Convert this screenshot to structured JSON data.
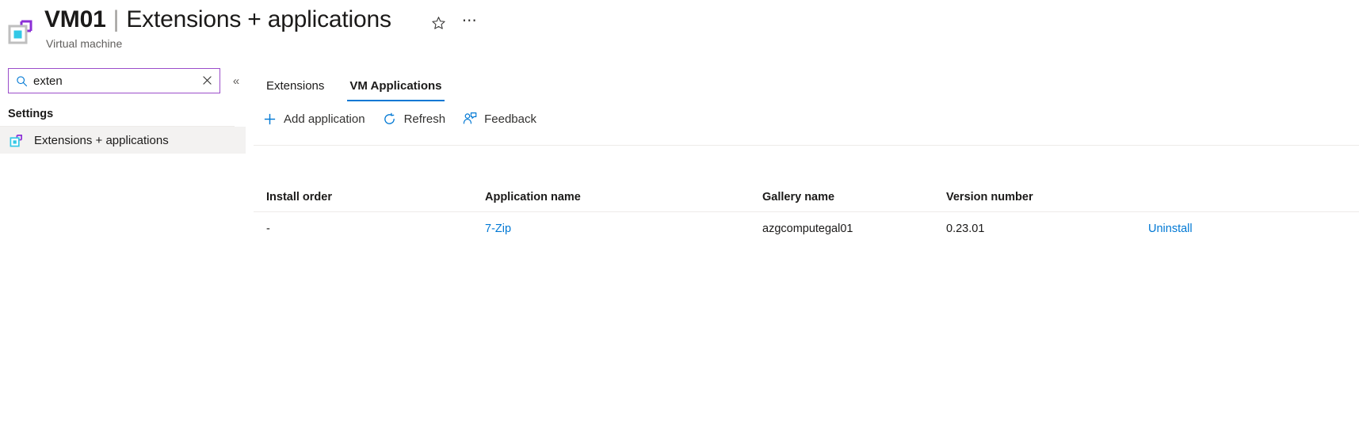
{
  "header": {
    "resource_name": "VM01",
    "separator": "|",
    "page_name": "Extensions + applications",
    "subtitle": "Virtual machine",
    "favorite_icon": "star-icon",
    "more_icon": "ellipsis-icon",
    "more_label": "⋯"
  },
  "sidebar": {
    "search": {
      "value": "exten",
      "placeholder": "Search",
      "search_icon": "search-icon",
      "clear_icon": "close-icon",
      "collapse_icon": "chevron-double-left-icon",
      "collapse_label": "«"
    },
    "section_title": "Settings",
    "items": [
      {
        "label": "Extensions + applications",
        "icon": "vm-extensions-icon",
        "selected": true
      }
    ]
  },
  "main": {
    "tabs": [
      {
        "label": "Extensions",
        "active": false
      },
      {
        "label": "VM Applications",
        "active": true
      }
    ],
    "toolbar": [
      {
        "label": "Add application",
        "icon": "plus-icon",
        "glyph": "+"
      },
      {
        "label": "Refresh",
        "icon": "refresh-icon"
      },
      {
        "label": "Feedback",
        "icon": "feedback-person-icon"
      }
    ],
    "table": {
      "columns": [
        "Install order",
        "Application name",
        "Gallery name",
        "Version number"
      ],
      "rows": [
        {
          "install_order": "-",
          "application_name": "7-Zip",
          "gallery_name": "azgcomputegal01",
          "version_number": "0.23.01",
          "action": "Uninstall"
        }
      ]
    }
  },
  "colors": {
    "accent_blue": "#0078d4",
    "focus_purple": "#9b4dca",
    "icon_cyan": "#32c8e6",
    "icon_purple": "#8b2fd6",
    "icon_gray": "#bfbfbf",
    "selected_bg": "#f3f2f1",
    "divider": "#edebe9"
  }
}
